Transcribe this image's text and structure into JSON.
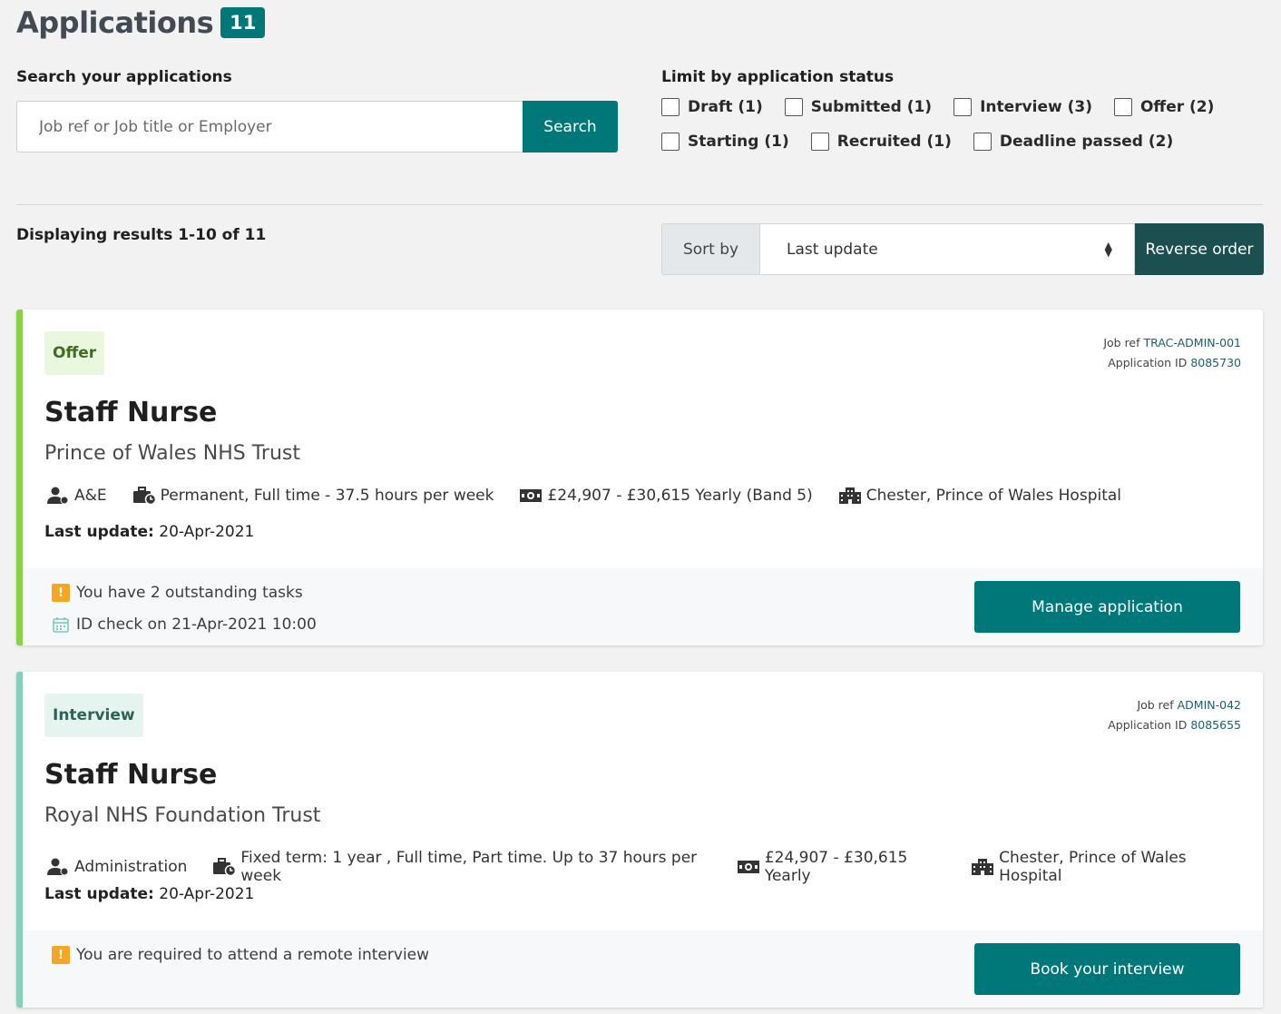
{
  "header": {
    "title": "Applications",
    "count": "11"
  },
  "search": {
    "label": "Search your applications",
    "placeholder": "Job ref or Job title or Employer",
    "value": "",
    "button_label": "Search"
  },
  "filters": {
    "label": "Limit by application status",
    "options": [
      "Draft (1)",
      "Submitted (1)",
      "Interview (3)",
      "Offer (2)",
      "Starting (1)",
      "Recruited (1)",
      "Deadline passed (2)"
    ]
  },
  "results": {
    "text": "Displaying results 1-10 of 11"
  },
  "sort": {
    "label": "Sort by",
    "selected": "Last update",
    "reverse_label": "Reverse order"
  },
  "colors": {
    "accent": "#00787a",
    "offer": "#8ad14a",
    "interview": "#86d0bb",
    "warning": "#f5a623"
  },
  "applications": [
    {
      "status": "Offer",
      "job_ref_label": "Job ref",
      "job_ref": "TRAC-ADMIN-001",
      "app_id_label": "Application ID",
      "app_id": "8085730",
      "title": "Staff Nurse",
      "employer": "Prince of Wales NHS Trust",
      "department": "A&E",
      "contract": "Permanent, Full time - 37.5 hours per week",
      "salary": "£24,907 - £30,615 Yearly (Band 5)",
      "location": "Chester, Prince of Wales Hospital",
      "last_update_label": "Last update:",
      "last_update": "20-Apr-2021",
      "notices": [
        {
          "icon": "warning-icon",
          "text": "You have 2 outstanding tasks"
        },
        {
          "icon": "calendar-icon",
          "text": "ID check on 21-Apr-2021 10:00"
        }
      ],
      "action_label": "Manage application"
    },
    {
      "status": "Interview",
      "job_ref_label": "Job ref",
      "job_ref": "ADMIN-042",
      "app_id_label": "Application ID",
      "app_id": "8085655",
      "title": "Staff Nurse",
      "employer": "Royal NHS Foundation Trust",
      "department": "Administration",
      "contract": "Fixed term: 1 year , Full time, Part time. Up to 37 hours per week",
      "salary": "£24,907 - £30,615 Yearly",
      "location": "Chester, Prince of Wales Hospital",
      "last_update_label": "Last update:",
      "last_update": "20-Apr-2021",
      "notices": [
        {
          "icon": "warning-icon",
          "text": "You are required to attend a remote interview"
        }
      ],
      "action_label": "Book your interview"
    }
  ]
}
